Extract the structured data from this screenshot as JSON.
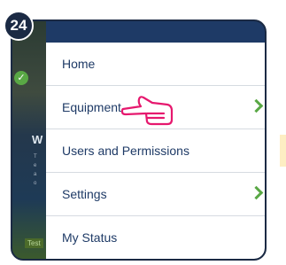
{
  "step_badge": "24",
  "menu": {
    "items": [
      {
        "label": "Home",
        "has_submenu": false
      },
      {
        "label": "Equipment",
        "has_submenu": true
      },
      {
        "label": "Users and Permissions",
        "has_submenu": false
      },
      {
        "label": "Settings",
        "has_submenu": true
      },
      {
        "label": "My Status",
        "has_submenu": false
      }
    ]
  },
  "background": {
    "heading": "W",
    "test_label": "Test"
  },
  "icons": {
    "pointer": "pointing-hand-icon",
    "submenu": "chevron-right-icon",
    "check": "check-circle-icon"
  },
  "colors": {
    "menu_text": "#1e3a66",
    "header": "#1e3a66",
    "chevron": "#59a845",
    "pointer": "#e6186e",
    "badge": "#1b2a44"
  }
}
